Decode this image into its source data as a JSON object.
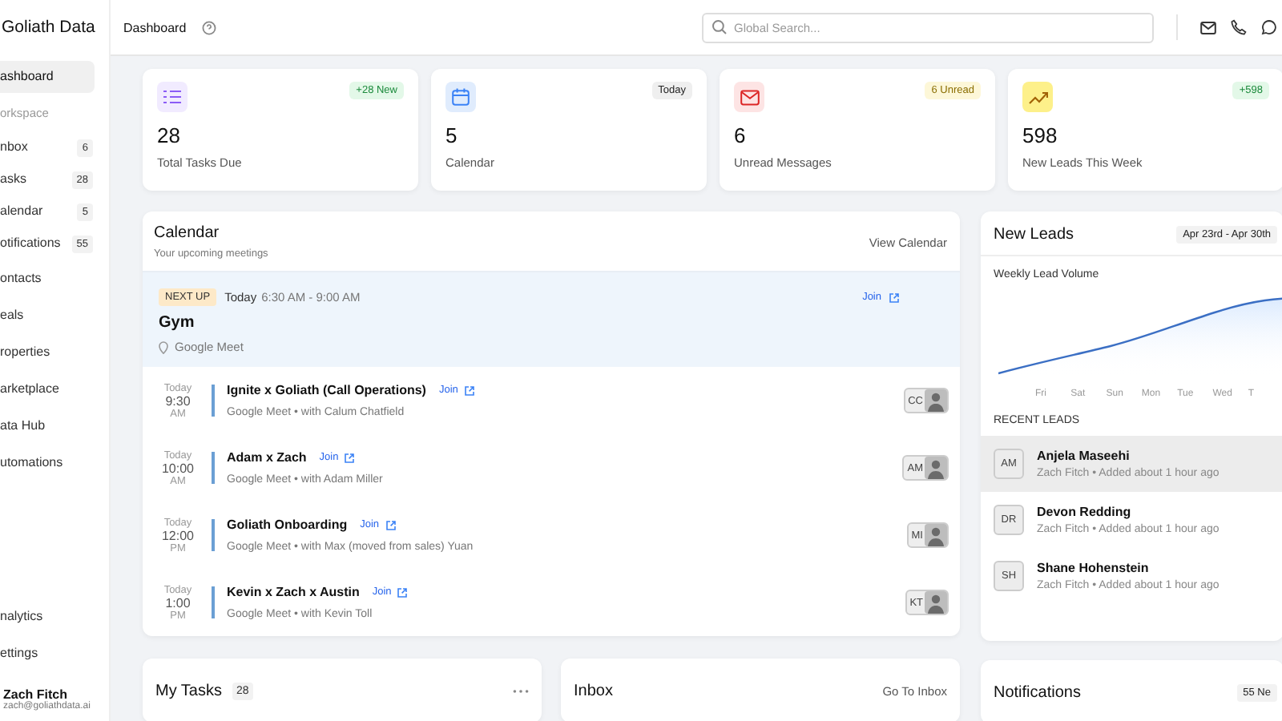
{
  "sidebar": {
    "brand": "Goliath Data",
    "items": [
      {
        "label": "ashboard",
        "selected": true,
        "kind": "link"
      },
      {
        "label": "orkspace",
        "kind": "section"
      },
      {
        "label": "nbox",
        "count": "6",
        "selected": false,
        "kind": "link"
      },
      {
        "label": "asks",
        "count": "28",
        "selected": false,
        "kind": "link"
      },
      {
        "label": "alendar",
        "count": "5",
        "selected": false,
        "kind": "link"
      },
      {
        "label": "otifications",
        "count": "55",
        "selected": false,
        "kind": "link"
      },
      {
        "label": "ontacts",
        "selected": false,
        "kind": "link"
      },
      {
        "label": "eals",
        "selected": false,
        "kind": "link"
      },
      {
        "label": "roperties",
        "selected": false,
        "kind": "link"
      },
      {
        "label": "arketplace",
        "selected": false,
        "kind": "link"
      },
      {
        "label": "ata Hub",
        "selected": false,
        "kind": "link"
      },
      {
        "label": "utomations",
        "selected": false,
        "kind": "link"
      }
    ],
    "bottom_items": [
      {
        "label": "nalytics"
      },
      {
        "label": "ettings"
      }
    ],
    "user": {
      "name": "Zach Fitch",
      "email": "zach@goliathdata.ai"
    }
  },
  "header": {
    "title": "Dashboard",
    "search": {
      "placeholder": "Global Search..."
    }
  },
  "stats": [
    {
      "kind": "tasks",
      "value": "28",
      "label": "Total Tasks Due",
      "badge": "+28 New"
    },
    {
      "kind": "calendar",
      "value": "5",
      "label": "Calendar",
      "badge": "Today"
    },
    {
      "kind": "mail",
      "value": "6",
      "label": "Unread Messages",
      "badge": "6 Unread"
    },
    {
      "kind": "leads",
      "value": "598",
      "label": "New Leads This Week",
      "badge": "+598"
    }
  ],
  "calendar": {
    "title": "Calendar",
    "subtitle": "Your upcoming meetings",
    "link": "View Calendar",
    "next_up": {
      "badge": "NEXT UP",
      "day": "Today",
      "time": "6:30 AM - 9:00 AM",
      "title": "Gym",
      "location": "Google Meet",
      "join": "Join"
    },
    "meetings": [
      {
        "day": "Today",
        "time": "9:30",
        "period": "AM",
        "title": "Ignite x Goliath (Call Operations)",
        "join": "Join",
        "details": "Google Meet • with Calum Chatfield",
        "initials": "CC"
      },
      {
        "day": "Today",
        "time": "10:00",
        "period": "AM",
        "title": "Adam x Zach",
        "join": "Join",
        "details": "Google Meet • with Adam Miller",
        "initials": "AM"
      },
      {
        "day": "Today",
        "time": "12:00",
        "period": "PM",
        "title": "Goliath Onboarding",
        "join": "Join",
        "details": "Google Meet • with Max (moved from sales) Yuan",
        "initials": "MI"
      },
      {
        "day": "Today",
        "time": "1:00",
        "period": "PM",
        "title": "Kevin x Zach x Austin",
        "join": "Join",
        "details": "Google Meet • with Kevin Toll",
        "initials": "KT"
      }
    ]
  },
  "new_leads": {
    "title": "New Leads",
    "range": "Apr 23rd - Apr 30th",
    "chart_title": "Weekly Lead Volume",
    "chart_days": [
      "Fri",
      "Sat",
      "Sun",
      "Mon",
      "Tue",
      "Wed",
      "T"
    ],
    "recent_title": "RECENT LEADS",
    "leads": [
      {
        "initials": "AM",
        "name": "Anjela Maseehi",
        "details": "Zach Fitch • Added about 1 hour ago",
        "selected": true
      },
      {
        "initials": "DR",
        "name": "Devon Redding",
        "details": "Zach Fitch • Added about 1 hour ago",
        "selected": false
      },
      {
        "initials": "SH",
        "name": "Shane Hohenstein",
        "details": "Zach Fitch • Added about 1 hour ago",
        "selected": false
      }
    ]
  },
  "tasks": {
    "title": "My Tasks",
    "count": "28"
  },
  "inbox": {
    "title": "Inbox",
    "link": "Go To Inbox"
  },
  "notifications": {
    "title": "Notifications",
    "badge": "55 Ne"
  }
}
